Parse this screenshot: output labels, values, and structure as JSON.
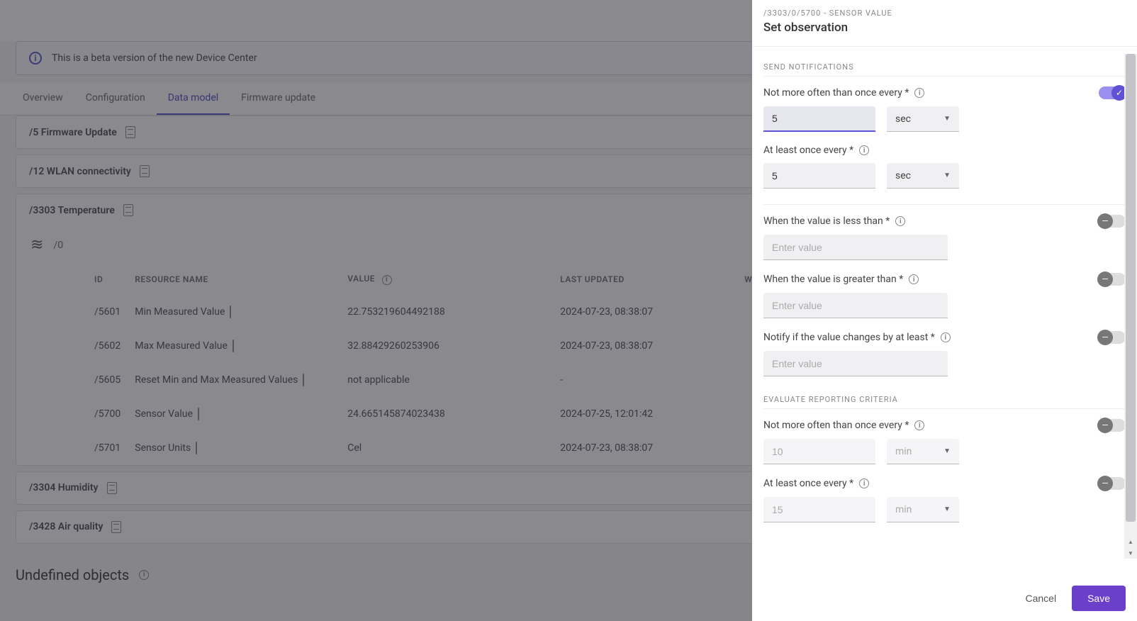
{
  "banner": {
    "text": "This is a beta version of the new Device Center"
  },
  "tabs": {
    "overview": "Overview",
    "configuration": "Configuration",
    "data_model": "Data model",
    "firmware_update": "Firmware update"
  },
  "objects": {
    "o5": "/5 Firmware Update",
    "o12": "/12 WLAN connectivity",
    "o3303": "/3303 Temperature",
    "o3304": "/3304 Humidity",
    "o3428": "/3428 Air quality"
  },
  "instance": {
    "path": "/0"
  },
  "table": {
    "headers": {
      "id": "ID",
      "resource_name": "RESOURCE NAME",
      "value": "VALUE",
      "last_updated": "LAST UPDATED",
      "wid": "WID"
    },
    "rows": [
      {
        "id": "/5601",
        "name": "Min Measured Value",
        "value": "22.753219604492188",
        "updated": "2024-07-23, 08:38:07",
        "icon": true
      },
      {
        "id": "/5602",
        "name": "Max Measured Value",
        "value": "32.88429260253906",
        "updated": "2024-07-23, 08:38:07",
        "icon": true
      },
      {
        "id": "/5605",
        "name": "Reset Min and Max Measured Values",
        "value": "not applicable",
        "updated": "-",
        "icon": true,
        "na": true
      },
      {
        "id": "/5700",
        "name": "Sensor Value",
        "value": "24.665145874023438",
        "updated": "2024-07-25, 12:01:42",
        "icon": true
      },
      {
        "id": "/5701",
        "name": "Sensor Units",
        "value": "Cel",
        "updated": "2024-07-23, 08:38:07",
        "icon": true
      }
    ]
  },
  "undefined_section": "Undefined objects",
  "panel": {
    "breadcrumb": "/3303/0/5700 - SENSOR VALUE",
    "title": "Set observation",
    "section_send": "SEND NOTIFICATIONS",
    "section_eval": "EVALUATE REPORTING CRITERIA",
    "labels": {
      "not_more_often": "Not more often than once every *",
      "at_least_once": "At least once every *",
      "less_than": "When the value is less than *",
      "greater_than": "When the value is greater than *",
      "changes_by": "Notify if the value changes by at least *"
    },
    "placeholders": {
      "enter_value": "Enter value"
    },
    "units": {
      "sec": "sec",
      "min": "min"
    },
    "values": {
      "send_pmin": "5",
      "send_pmax": "5",
      "eval_pmin": "10",
      "eval_pmax": "15"
    },
    "buttons": {
      "cancel": "Cancel",
      "save": "Save"
    }
  }
}
